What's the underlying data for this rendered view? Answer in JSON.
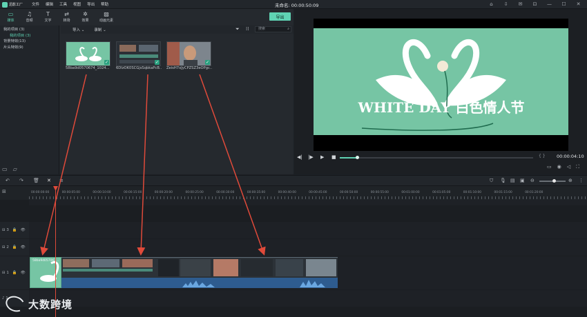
{
  "app": {
    "logo_text": "迅影工厂",
    "menu": [
      "文件",
      "编辑",
      "工具",
      "视图",
      "导出",
      "帮助"
    ],
    "project_title": "未命名: 00:00:50:09"
  },
  "window_buttons": [
    "⌂",
    "⇩",
    "✉",
    "⊡",
    "—",
    "☐",
    "✕"
  ],
  "library": {
    "tabs": [
      {
        "label": "媒体",
        "icon": "folder-icon",
        "glyph": "▭"
      },
      {
        "label": "音频",
        "icon": "music-icon",
        "glyph": "♫"
      },
      {
        "label": "文字",
        "icon": "text-icon",
        "glyph": "T"
      },
      {
        "label": "转场",
        "icon": "transition-icon",
        "glyph": "⇄"
      },
      {
        "label": "效果",
        "icon": "effects-icon",
        "glyph": "✲"
      },
      {
        "label": "动画元素",
        "icon": "image-icon",
        "glyph": "▨"
      }
    ],
    "export_label": "导出",
    "tree": {
      "root": "我的项目 (3)",
      "selected": "我的项目 (3)",
      "items": [
        "背景特效(13)",
        "片头特效(9)"
      ]
    },
    "import_label": "导入",
    "record_label": "录制",
    "search_placeholder": "搜索",
    "media": [
      {
        "name": "58ba9d0570674_1024...",
        "kind": "swan"
      },
      {
        "name": "6DIzOK0SCGjsSqbkaPcB...",
        "kind": "grid"
      },
      {
        "name": "ZeisH7oJyCPZSZ3eOPgc...",
        "kind": "person"
      }
    ]
  },
  "preview": {
    "title_text": "WHITE DAY 白色情人节",
    "timecode": "00:00:04:10",
    "brackets": "{   }",
    "progress_fraction": 0.09
  },
  "timeline": {
    "ruler_labels": [
      "00:00:00:00",
      "00:00:05:00",
      "00:00:10:00",
      "00:00:15:00",
      "00:00:20:00",
      "00:00:25:00",
      "00:00:30:00",
      "00:00:35:00",
      "00:00:40:00",
      "00:00:45:00",
      "00:00:50:00",
      "00:00:55:00",
      "00:01:00:00",
      "00:01:05:00",
      "00:01:10:00",
      "00:01:15:00",
      "00:01:20:00"
    ],
    "tracks": [
      {
        "label": "3",
        "icon": "video-track-icon"
      },
      {
        "label": "2",
        "icon": "video-track-icon"
      },
      {
        "label": "1",
        "icon": "video-track-icon"
      },
      {
        "label": "1",
        "icon": "audio-track-icon"
      }
    ],
    "clip_label": "58ba9d057067..."
  },
  "watermark": {
    "text": "大数跨境"
  },
  "colors": {
    "accent": "#5fd3b3",
    "arrow": "#e04a3a",
    "swan_bg": "#76c5a4",
    "audio": "#2e5c8f"
  }
}
